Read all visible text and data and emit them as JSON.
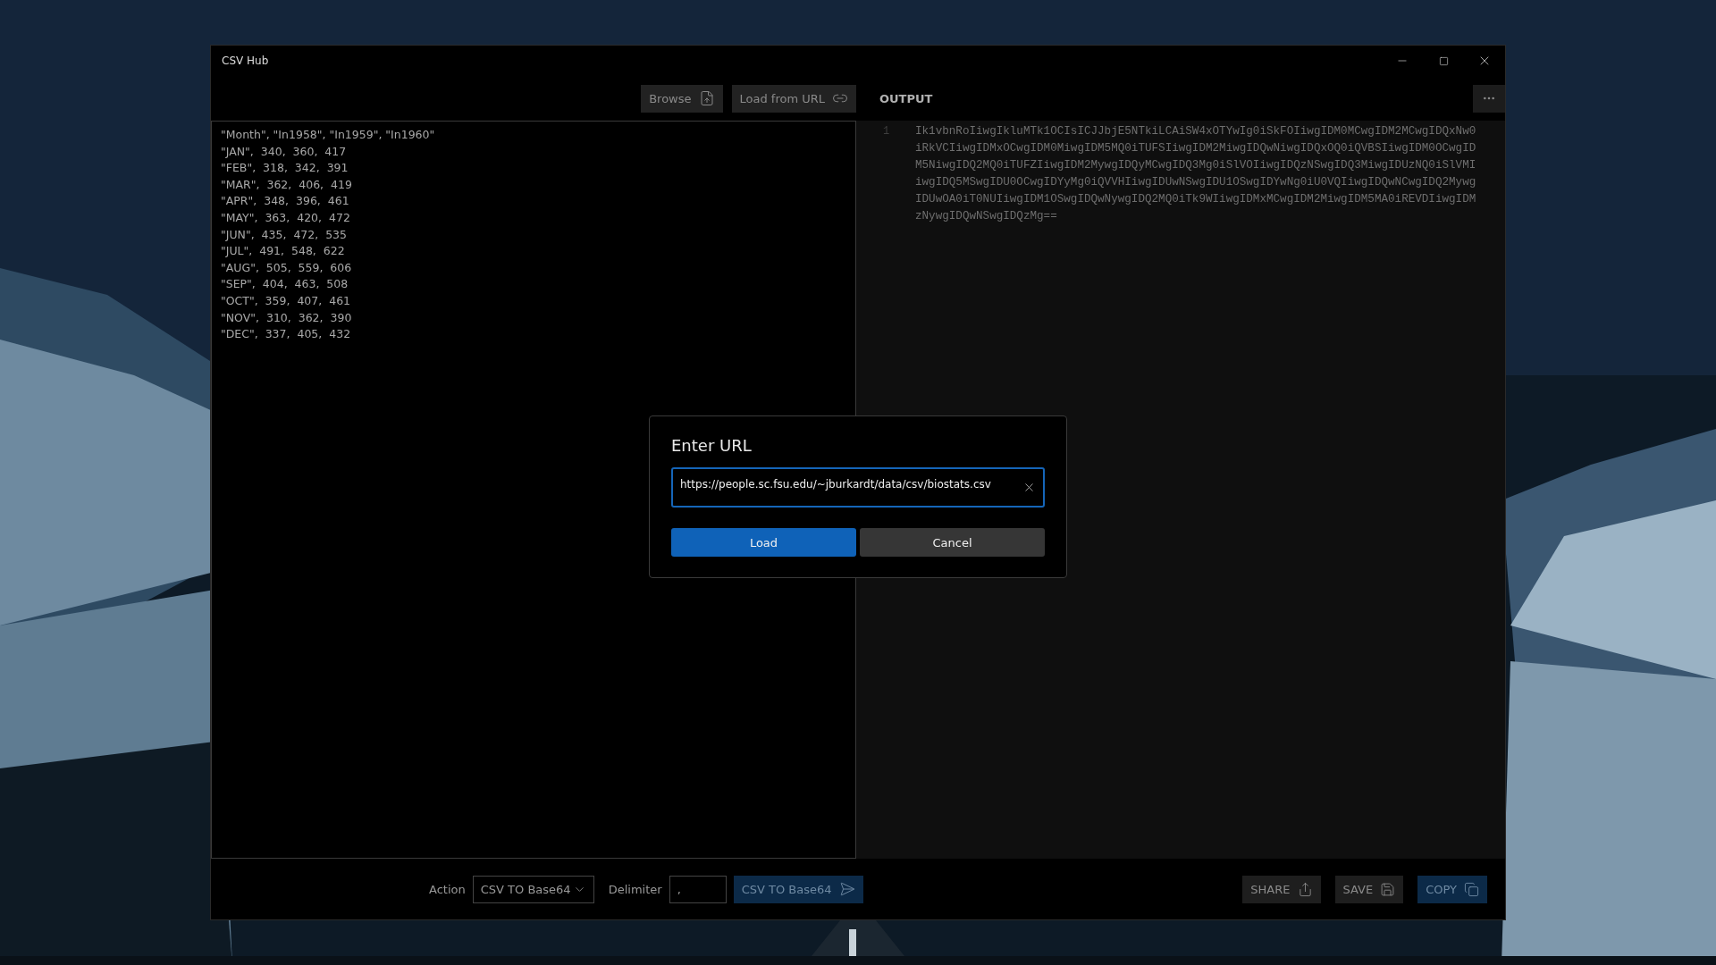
{
  "window": {
    "title": "CSV Hub"
  },
  "toolbar": {
    "browse": "Browse",
    "load_url": "Load from URL",
    "output_header": "OUTPUT"
  },
  "input_lines": [
    "\"Month\", \"In1958\", \"In1959\", \"In1960\"",
    "\"JAN\",  340,  360,  417",
    "\"FEB\",  318,  342,  391",
    "\"MAR\",  362,  406,  419",
    "\"APR\",  348,  396,  461",
    "\"MAY\",  363,  420,  472",
    "\"JUN\",  435,  472,  535",
    "\"JUL\",  491,  548,  622",
    "\"AUG\",  505,  559,  606",
    "\"SEP\",  404,  463,  508",
    "\"OCT\",  359,  407,  461",
    "\"NOV\",  310,  362,  390",
    "\"DEC\",  337,  405,  432"
  ],
  "output": {
    "line_number": "1",
    "lines": [
      "Ik1vbnRoIiwgIkluMTk1OCIsICJJbjE5NTkiLCAiSW4xOTYwIg0iSkFOIiwgIDM0MCwgIDM2MCwgIDQxNw0",
      "iRkVCIiwgIDMxOCwgIDM0MiwgIDM5MQ0iTUFSIiwgIDM2MiwgIDQwNiwgIDQxOQ0iQVBSIiwgIDM0OCwgID",
      "M5NiwgIDQ2MQ0iTUFZIiwgIDM2MywgIDQyMCwgIDQ3Mg0iSlVOIiwgIDQzNSwgIDQ3MiwgIDUzNQ0iSlVMI",
      "iwgIDQ5MSwgIDU0OCwgIDYyMg0iQVVHIiwgIDUwNSwgIDU1OSwgIDYwNg0iU0VQIiwgIDQwNCwgIDQ2Mywg",
      "IDUwOA0iT0NUIiwgIDM1OSwgIDQwNywgIDQ2MQ0iTk9WIiwgIDMxMCwgIDM2MiwgIDM5MA0iREVDIiwgIDM",
      "zNywgIDQwNSwgIDQzMg=="
    ]
  },
  "bottom_bar": {
    "action_label": "Action",
    "action_value": "CSV TO Base64",
    "delimiter_label": "Delimiter",
    "delimiter_value": ",",
    "convert": "CSV TO Base64",
    "share": "SHARE",
    "save": "SAVE",
    "copy": "COPY"
  },
  "dialog": {
    "title": "Enter URL",
    "url_value": "https://people.sc.fsu.edu/~jburkardt/data/csv/biostats.csv",
    "buttons": [
      {
        "label": "Load",
        "kind": "primary"
      },
      {
        "label": "Cancel",
        "kind": "secondary"
      }
    ]
  }
}
